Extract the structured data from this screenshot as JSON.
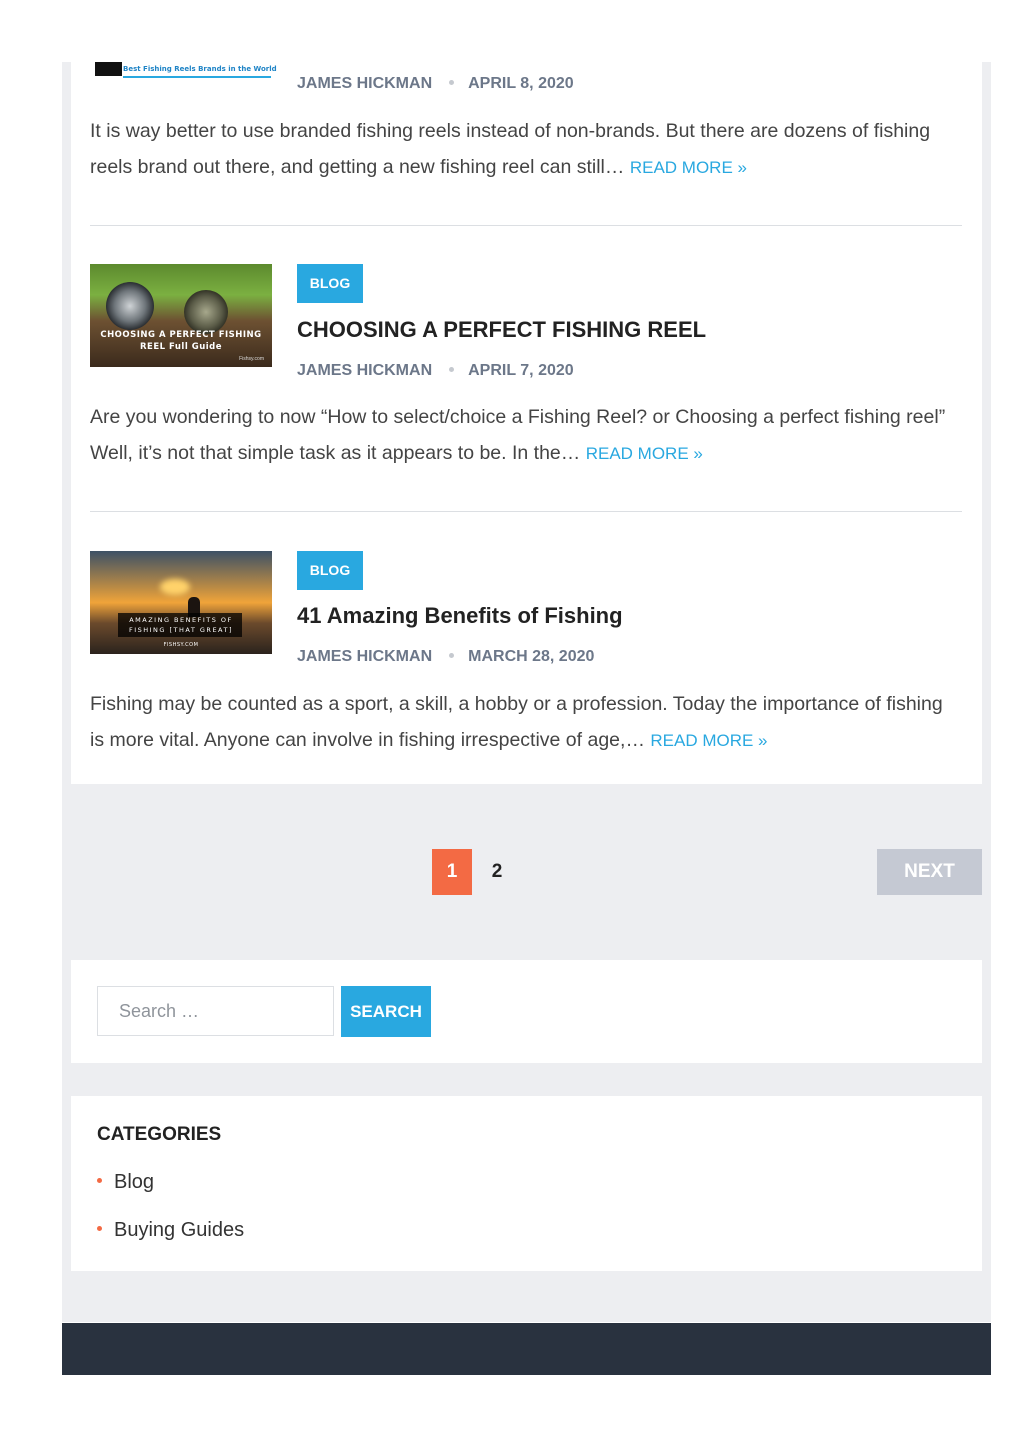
{
  "posts": [
    {
      "thumb_text": "Best Fishing Reels Brands in the World",
      "author": "JAMES HICKMAN",
      "date": "APRIL 8, 2020",
      "excerpt": "It is way better to use branded fishing reels instead of non-brands. But there are dozens of fishing reels brand out there, and getting a new fishing reel can still…",
      "read_more": "READ MORE »"
    },
    {
      "thumb_text_1": "CHOOSING A PERFECT FISHING",
      "thumb_text_2": "REEL Full Guide",
      "thumb_credit": "Fishsy.com",
      "category": "BLOG",
      "title": "CHOOSING A PERFECT FISHING REEL",
      "author": "JAMES HICKMAN",
      "date": "APRIL 7, 2020",
      "excerpt": "Are you wondering to now “How to select/choice a Fishing Reel? or Choosing a perfect fishing reel” Well, it’s not that simple task as it appears to be. In the…",
      "read_more": "READ MORE »"
    },
    {
      "thumb_text_1": "AMAZING BENEFITS OF",
      "thumb_text_2": "FISHING [THAT GREAT]",
      "thumb_credit": "FISHSY.COM",
      "category": "BLOG",
      "title": "41 Amazing Benefits of Fishing",
      "author": "JAMES HICKMAN",
      "date": "MARCH 28, 2020",
      "excerpt": "Fishing may be counted as a sport, a skill, a hobby or a profession. Today the importance of fishing is more vital. Anyone can involve in fishing irrespective of age,…",
      "read_more": "READ MORE »"
    }
  ],
  "pagination": {
    "current": "1",
    "next_page": "2",
    "next_label": "NEXT"
  },
  "search": {
    "placeholder": "Search …",
    "button_label": "SEARCH"
  },
  "categories": {
    "title": "CATEGORIES",
    "items": [
      "Blog",
      "Buying Guides"
    ]
  },
  "colors": {
    "accent": "#29a8e0",
    "current_page": "#f36a44",
    "footer": "#29323f",
    "background": "#edeef1"
  }
}
